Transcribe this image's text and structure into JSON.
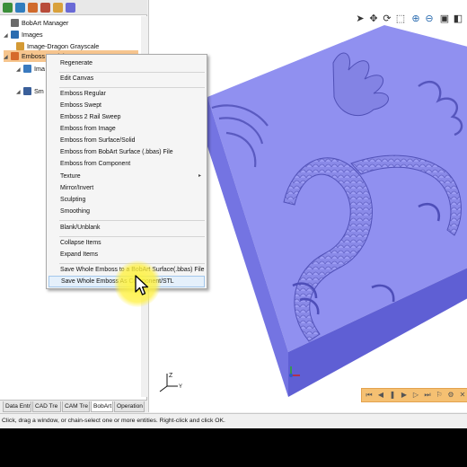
{
  "tree": {
    "items": [
      {
        "label": "BobArt Manager",
        "icon": "bobart-manager-icon",
        "color": "#6b6b6b"
      },
      {
        "label": "Images",
        "icon": "folder-icon",
        "color": "#2b6cb0"
      },
      {
        "label": "Image-Dragon Grayscale",
        "icon": "image-icon",
        "color": "#d49a35"
      },
      {
        "label": "Emboss Model",
        "icon": "emboss-icon",
        "color": "#d66a2b"
      },
      {
        "label": "Ima",
        "icon": "image-icon",
        "color": "#3a7abf"
      },
      {
        "label": "Sm",
        "icon": "smoothing-icon",
        "color": "#3a5f9a"
      }
    ]
  },
  "bottom_tabs": [
    "Data Entr",
    "CAD Tre",
    "CAM Tre",
    "BobArt",
    "Operation"
  ],
  "context_menu": {
    "items": [
      {
        "label": "Regenerate"
      },
      {
        "label": "Edit Canvas"
      },
      {
        "label": "Emboss Regular"
      },
      {
        "label": "Emboss Swept"
      },
      {
        "label": "Emboss 2 Rail Sweep"
      },
      {
        "label": "Emboss from Image"
      },
      {
        "label": "Emboss from Surface/Solid"
      },
      {
        "label": "Emboss from BobArt Surface (.bbas) File"
      },
      {
        "label": "Emboss from Component"
      },
      {
        "label": "Texture",
        "submenu": "▸"
      },
      {
        "label": "Mirror/Invert"
      },
      {
        "label": "Sculpting"
      },
      {
        "label": "Smoothing"
      },
      {
        "label": "Blank/Unblank"
      },
      {
        "label": "Collapse Items"
      },
      {
        "label": "Expand Items"
      },
      {
        "label": "Save Whole Emboss to a BobArt Surface(.bbas) File"
      },
      {
        "label": "Save Whole Emboss As Component/STL"
      }
    ]
  },
  "status_text": "Click, drag a window, or chain-select one or more entities. Right-click and click OK.",
  "colors": {
    "accent_orange": "#f5c072",
    "emboss_purple": "#8f8fef",
    "selection": "#f6c58e",
    "highlight": "#fff23c"
  }
}
